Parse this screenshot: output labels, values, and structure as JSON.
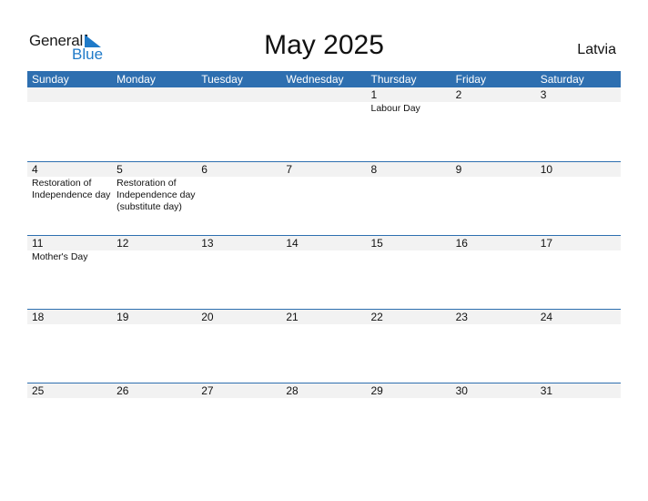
{
  "logo": {
    "text_top": "General",
    "text_bottom": "Blue"
  },
  "header": {
    "title": "May 2025",
    "country": "Latvia"
  },
  "colors": {
    "accent": "#2e6fb0",
    "date_strip": "#f2f2f2",
    "logo_blue": "#1f7ac8"
  },
  "weekdays": [
    "Sunday",
    "Monday",
    "Tuesday",
    "Wednesday",
    "Thursday",
    "Friday",
    "Saturday"
  ],
  "weeks": [
    [
      {
        "day": "",
        "holiday": ""
      },
      {
        "day": "",
        "holiday": ""
      },
      {
        "day": "",
        "holiday": ""
      },
      {
        "day": "",
        "holiday": ""
      },
      {
        "day": "1",
        "holiday": "Labour Day"
      },
      {
        "day": "2",
        "holiday": ""
      },
      {
        "day": "3",
        "holiday": ""
      }
    ],
    [
      {
        "day": "4",
        "holiday": "Restoration of Independence day"
      },
      {
        "day": "5",
        "holiday": "Restoration of Independence day (substitute day)"
      },
      {
        "day": "6",
        "holiday": ""
      },
      {
        "day": "7",
        "holiday": ""
      },
      {
        "day": "8",
        "holiday": ""
      },
      {
        "day": "9",
        "holiday": ""
      },
      {
        "day": "10",
        "holiday": ""
      }
    ],
    [
      {
        "day": "11",
        "holiday": "Mother's Day"
      },
      {
        "day": "12",
        "holiday": ""
      },
      {
        "day": "13",
        "holiday": ""
      },
      {
        "day": "14",
        "holiday": ""
      },
      {
        "day": "15",
        "holiday": ""
      },
      {
        "day": "16",
        "holiday": ""
      },
      {
        "day": "17",
        "holiday": ""
      }
    ],
    [
      {
        "day": "18",
        "holiday": ""
      },
      {
        "day": "19",
        "holiday": ""
      },
      {
        "day": "20",
        "holiday": ""
      },
      {
        "day": "21",
        "holiday": ""
      },
      {
        "day": "22",
        "holiday": ""
      },
      {
        "day": "23",
        "holiday": ""
      },
      {
        "day": "24",
        "holiday": ""
      }
    ],
    [
      {
        "day": "25",
        "holiday": ""
      },
      {
        "day": "26",
        "holiday": ""
      },
      {
        "day": "27",
        "holiday": ""
      },
      {
        "day": "28",
        "holiday": ""
      },
      {
        "day": "29",
        "holiday": ""
      },
      {
        "day": "30",
        "holiday": ""
      },
      {
        "day": "31",
        "holiday": ""
      }
    ]
  ]
}
